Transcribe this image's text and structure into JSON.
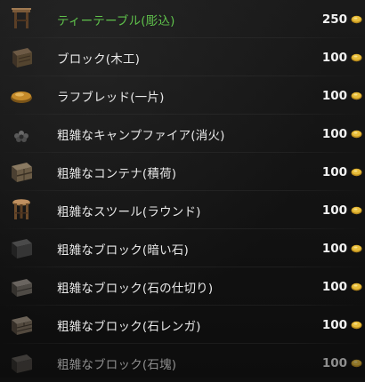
{
  "items": [
    {
      "name": "ティーテーブル(彫込)",
      "price": "250",
      "icon": "tea-table-icon"
    },
    {
      "name": "ブロック(木工)",
      "price": "100",
      "icon": "wood-block-icon"
    },
    {
      "name": "ラフブレッド(一片)",
      "price": "100",
      "icon": "bread-icon"
    },
    {
      "name": "粗雑なキャンプファイア(消火)",
      "price": "100",
      "icon": "campfire-icon"
    },
    {
      "name": "粗雑なコンテナ(積荷)",
      "price": "100",
      "icon": "container-icon"
    },
    {
      "name": "粗雑なスツール(ラウンド)",
      "price": "100",
      "icon": "stool-icon"
    },
    {
      "name": "粗雑なブロック(暗い石)",
      "price": "100",
      "icon": "dark-stone-block-icon"
    },
    {
      "name": "粗雑なブロック(石の仕切り)",
      "price": "100",
      "icon": "stone-divider-block-icon"
    },
    {
      "name": "粗雑なブロック(石レンガ)",
      "price": "100",
      "icon": "stone-brick-block-icon"
    },
    {
      "name": "粗雑なブロック(石塊)",
      "price": "100",
      "icon": "stone-lump-block-icon"
    }
  ],
  "currency_icon": "gold-coin-icon",
  "colors": {
    "highlight_text": "#5fc14b",
    "normal_text": "#e8e8e8",
    "dim_text": "#8e8e8e",
    "coin": "#d9a928"
  }
}
